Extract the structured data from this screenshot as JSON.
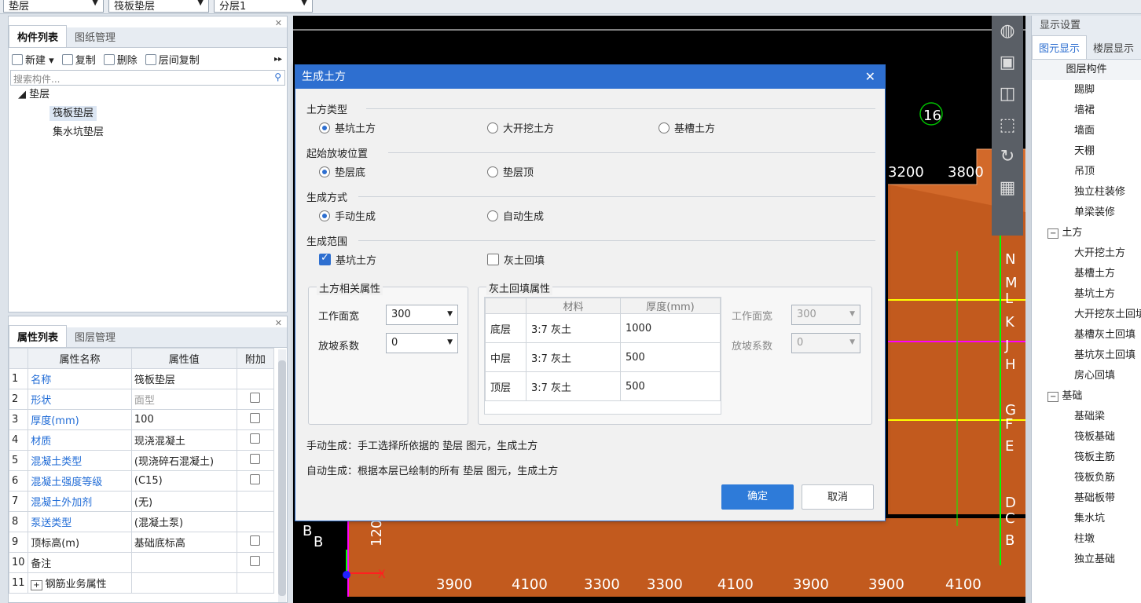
{
  "topbar": {
    "combo1": "垫层",
    "combo2": "筏板垫层",
    "combo3": "分层1"
  },
  "component_panel": {
    "tabs": [
      "构件列表",
      "图纸管理"
    ],
    "tools": [
      "新建",
      "复制",
      "删除",
      "层间复制"
    ],
    "search_placeholder": "搜索构件...",
    "tree_root": "垫层",
    "tree_items": [
      "筏板垫层",
      "集水坑垫层"
    ]
  },
  "prop_panel": {
    "tabs": [
      "属性列表",
      "图层管理"
    ],
    "headers": [
      "属性名称",
      "属性值",
      "附加"
    ],
    "rows": [
      {
        "n": "1",
        "name": "名称",
        "value": "筏板垫层"
      },
      {
        "n": "2",
        "name": "形状",
        "value": "面型"
      },
      {
        "n": "3",
        "name": "厚度(mm)",
        "value": "100"
      },
      {
        "n": "4",
        "name": "材质",
        "value": "现浇混凝土"
      },
      {
        "n": "5",
        "name": "混凝土类型",
        "value": "(现浇碎石混凝土)"
      },
      {
        "n": "6",
        "name": "混凝土强度等级",
        "value": "(C15)"
      },
      {
        "n": "7",
        "name": "混凝土外加剂",
        "value": "(无)"
      },
      {
        "n": "8",
        "name": "泵送类型",
        "value": "(混凝土泵)"
      },
      {
        "n": "9",
        "name": "顶标高(m)",
        "value": "基础底标高"
      },
      {
        "n": "10",
        "name": "备注",
        "value": ""
      },
      {
        "n": "11",
        "name": "钢筋业务属性",
        "value": ""
      }
    ]
  },
  "canvas": {
    "bottom_dims": [
      "3900",
      "4100",
      "3300",
      "3300",
      "4100",
      "3900",
      "3900",
      "4100"
    ],
    "top_dims": [
      "3200",
      "3800"
    ],
    "axis_top": "16",
    "axis_right": [
      "N",
      "M",
      "L",
      "K",
      "J",
      "H",
      "G",
      "F",
      "E",
      "D",
      "C",
      "B"
    ],
    "axis_left": [
      "B",
      "B"
    ],
    "left_dim": "120"
  },
  "right_panel": {
    "title": "显示设置",
    "tabs": [
      "图元显示",
      "楼层显示"
    ],
    "header": "图层构件",
    "items": [
      "踢脚",
      "墙裙",
      "墙面",
      "天棚",
      "吊顶",
      "独立柱装修",
      "单梁装修"
    ],
    "group1": "土方",
    "group1_items": [
      "大开挖土方",
      "基槽土方",
      "基坑土方",
      "大开挖灰土回填",
      "基槽灰土回填",
      "基坑灰土回填",
      "房心回填"
    ],
    "group2": "基础",
    "group2_items": [
      "基础梁",
      "筏板基础",
      "筏板主筋",
      "筏板负筋",
      "基础板带",
      "集水坑",
      "柱墩",
      "独立基础"
    ]
  },
  "dialog": {
    "title": "生成土方",
    "s1": {
      "label": "土方类型",
      "opts": [
        "基坑土方",
        "大开挖土方",
        "基槽土方"
      ]
    },
    "s2": {
      "label": "起始放坡位置",
      "opts": [
        "垫层底",
        "垫层顶"
      ]
    },
    "s3": {
      "label": "生成方式",
      "opts": [
        "手动生成",
        "自动生成"
      ]
    },
    "s4": {
      "label": "生成范围",
      "opts": [
        "基坑土方",
        "灰土回填"
      ]
    },
    "g1": {
      "label": "土方相关属性",
      "work_label": "工作面宽",
      "work_val": "300",
      "slope_label": "放坡系数",
      "slope_val": "0"
    },
    "g2": {
      "label": "灰土回填属性",
      "col_mat": "材料",
      "col_thk": "厚度(mm)",
      "rows": [
        {
          "layer": "底层",
          "mat": "3:7 灰土",
          "thk": "1000"
        },
        {
          "layer": "中层",
          "mat": "3:7 灰土",
          "thk": "500"
        },
        {
          "layer": "顶层",
          "mat": "3:7 灰土",
          "thk": "500"
        }
      ],
      "work_label": "工作面宽",
      "work_val": "300",
      "slope_label": "放坡系数",
      "slope_val": "0"
    },
    "note1": "手动生成：手工选择所依据的 垫层 图元，生成土方",
    "note2": "自动生成：根据本层已绘制的所有 垫层 图元，生成土方",
    "ok": "确定",
    "cancel": "取消"
  }
}
